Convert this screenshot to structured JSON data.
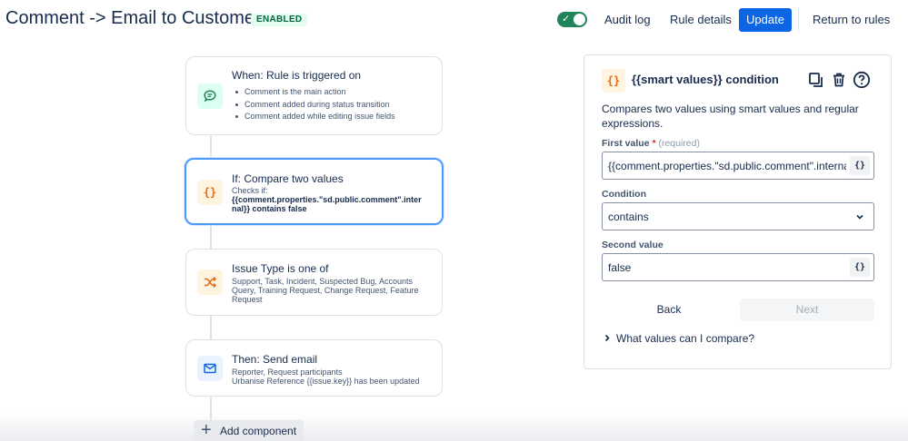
{
  "header": {
    "title": "Comment -> Email to Customer",
    "status": "ENABLED",
    "audit_log": "Audit log",
    "rule_details": "Rule details",
    "update": "Update",
    "return": "Return to rules"
  },
  "flow": {
    "trigger": {
      "title": "When: Rule is triggered on",
      "items": [
        "Comment is the main action",
        "Comment added during status transition",
        "Comment added while editing issue fields"
      ]
    },
    "condition": {
      "title": "If: Compare two values",
      "line1": "Checks if:",
      "line2": "{{comment.properties.\"sd.public.comment\".inter",
      "line3": "nal}} contains false"
    },
    "issue_type": {
      "title": "Issue Type is one of",
      "line1": "Support, Task, Incident, Suspected Bug, Accounts",
      "line2": "Query, Training Request, Change Request, Feature",
      "line3": "Request"
    },
    "action": {
      "title": "Then: Send email",
      "line1": "Reporter, Request participants",
      "line2": "Urbanise Reference {{issue.key}} has been updated"
    },
    "add_component": "Add component"
  },
  "panel": {
    "icon_text": "{}",
    "title": "{{smart values}} condition",
    "description": "Compares two values using smart values and regular expressions.",
    "first_value_label": "First value",
    "required_star": "*",
    "required_text": "(required)",
    "first_value": "{{comment.properties.\"sd.public.comment\".internal",
    "smart_value_btn": "{}",
    "condition_label": "Condition",
    "condition_value": "contains",
    "second_value_label": "Second value",
    "second_value": "false",
    "back": "Back",
    "next": "Next",
    "expander": "What values can I compare?"
  },
  "colors": {
    "primary": "#0c66e4",
    "toggle_on": "#1f845a",
    "selected_border": "#4c9aff",
    "condition_icon": "#e56910",
    "trigger_icon": "#1f845a",
    "action_icon": "#0c66e4"
  }
}
